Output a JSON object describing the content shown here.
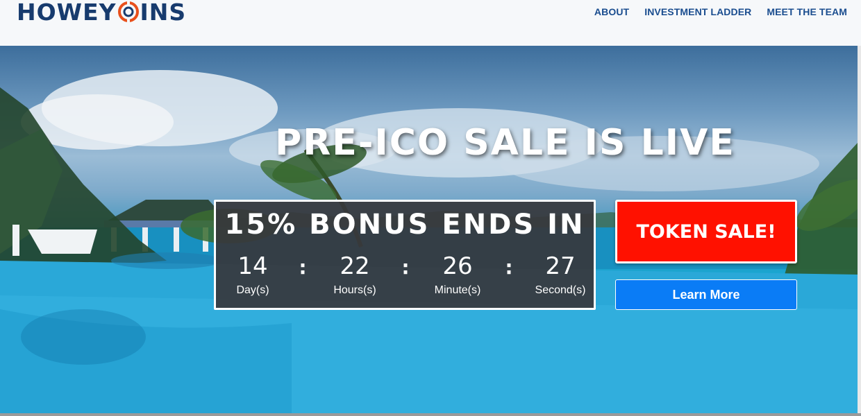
{
  "brand": {
    "logo_text_left": "HOWEY",
    "logo_text_right": "INS",
    "logo_color": "#173b6e",
    "coin_color": "#e8501c"
  },
  "nav": {
    "items": [
      {
        "label": "ABOUT"
      },
      {
        "label": "INVESTMENT LADDER"
      },
      {
        "label": "MEET THE TEAM"
      }
    ],
    "color": "#1a4d8f"
  },
  "hero": {
    "headline": "PRE-ICO SALE IS LIVE",
    "countdown": {
      "title": "15% BONUS ENDS IN",
      "separator": ":",
      "units": [
        {
          "value": "14",
          "label": "Day(s)"
        },
        {
          "value": "22",
          "label": "Hours(s)"
        },
        {
          "value": "26",
          "label": "Minute(s)"
        },
        {
          "value": "27",
          "label": "Second(s)"
        }
      ]
    },
    "token_button": "TOKEN SALE!",
    "learn_button": "Learn More"
  },
  "colors": {
    "token_button_bg": "#ff1100",
    "learn_button_bg": "#0a7cf6",
    "countdown_bg": "#37373c"
  }
}
